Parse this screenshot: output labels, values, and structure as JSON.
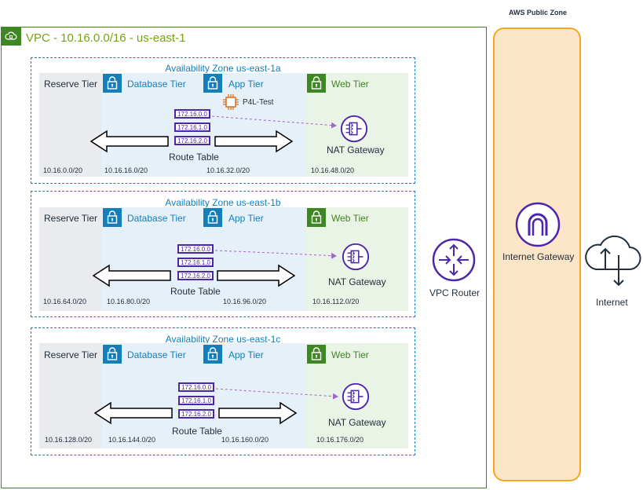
{
  "vpc": {
    "title": "VPC - 10.16.0.0/16 - us-east-1"
  },
  "public_zone": {
    "title": "AWS Public Zone"
  },
  "internet_gateway": {
    "label": "Internet Gateway"
  },
  "internet": {
    "label": "Internet"
  },
  "vpc_router": {
    "label": "VPC Router"
  },
  "azs": [
    {
      "title": "Availability Zone us-east-1a",
      "tiers": [
        "Reserve Tier",
        "Database Tier",
        "App Tier",
        "Web Tier"
      ],
      "cidrs": [
        "10.16.0.0/20",
        "10.16.16.0/20",
        "10.16.32.0/20",
        "10.16.48.0/20"
      ],
      "routes": [
        "172.16.0.0",
        "172.16.1.0",
        "172.16.2.0"
      ],
      "route_table_label": "Route Table",
      "nat_label": "NAT Gateway",
      "instance_label": "P4L-Test"
    },
    {
      "title": "Availability Zone us-east-1b",
      "tiers": [
        "Reserve Tier",
        "Database Tier",
        "App Tier",
        "Web Tier"
      ],
      "cidrs": [
        "10.16.64.0/20",
        "10.16.80.0/20",
        "10.16.96.0/20",
        "10.16.112.0/20"
      ],
      "routes": [
        "172.16.0.0",
        "172.16.1.0",
        "172.16.2.0"
      ],
      "route_table_label": "Route Table",
      "nat_label": "NAT Gateway"
    },
    {
      "title": "Availability Zone us-east-1c",
      "tiers": [
        "Reserve Tier",
        "Database Tier",
        "App Tier",
        "Web Tier"
      ],
      "cidrs": [
        "10.16.128.0/20",
        "10.16.144.0/20",
        "10.16.160.0/20",
        "10.16.176.0/20"
      ],
      "routes": [
        "172.16.0.0",
        "172.16.1.0",
        "172.16.2.0"
      ],
      "route_table_label": "Route Table",
      "nat_label": "NAT Gateway"
    }
  ],
  "colors": {
    "vpc_green": "#3f8624",
    "vpc_title": "#7aa116",
    "az_blue": "#147eba",
    "route_purple": "#4d27aa",
    "ec2_orange": "#d86613",
    "public_zone_fill": "#fde6c8",
    "public_zone_border": "#f5a623"
  }
}
